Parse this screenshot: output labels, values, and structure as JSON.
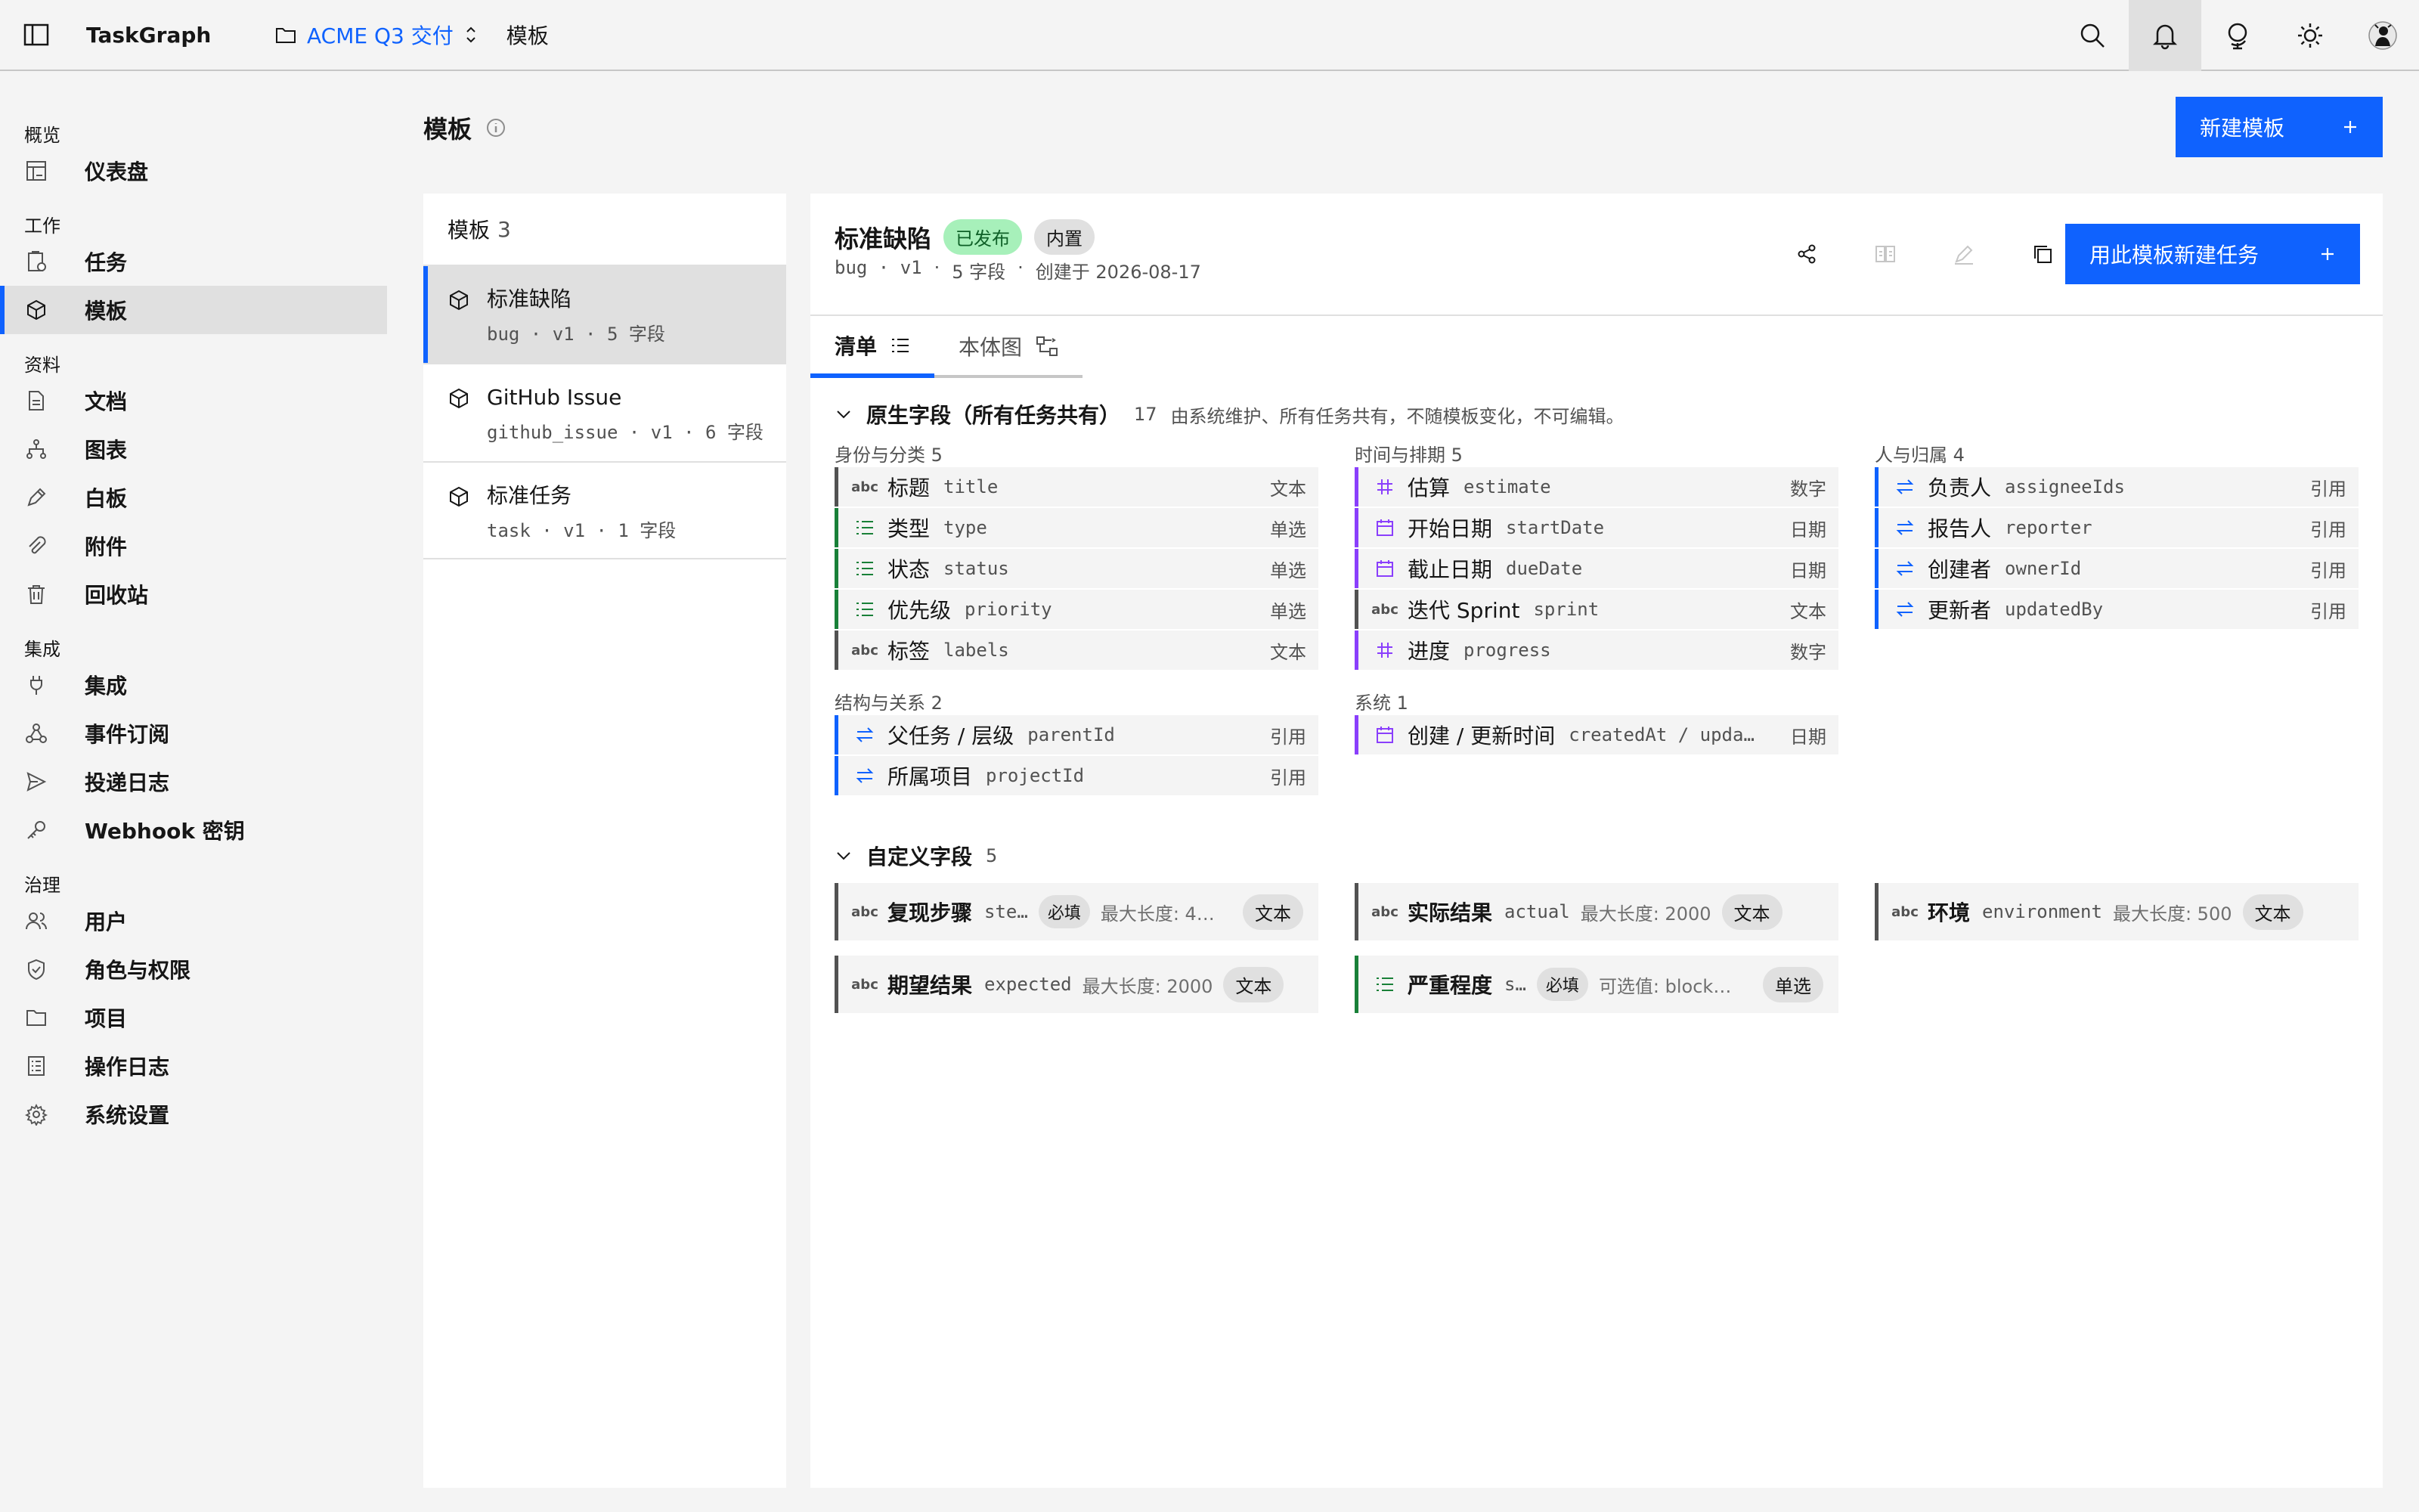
{
  "topbar": {
    "brand": "TaskGraph",
    "project": "ACME Q3 交付",
    "breadcrumb_current": "模板"
  },
  "sidebar": {
    "groups": [
      {
        "label": "概览",
        "items": [
          {
            "label": "仪表盘",
            "icon": "dashboard-icon"
          }
        ]
      },
      {
        "label": "工作",
        "items": [
          {
            "label": "任务",
            "icon": "task-icon"
          },
          {
            "label": "模板",
            "icon": "cube-icon",
            "active": true
          }
        ]
      },
      {
        "label": "资料",
        "items": [
          {
            "label": "文档",
            "icon": "document-icon"
          },
          {
            "label": "图表",
            "icon": "tree-icon"
          },
          {
            "label": "白板",
            "icon": "pen-icon"
          },
          {
            "label": "附件",
            "icon": "paperclip-icon"
          },
          {
            "label": "回收站",
            "icon": "trash-icon"
          }
        ]
      },
      {
        "label": "集成",
        "items": [
          {
            "label": "集成",
            "icon": "plug-icon"
          },
          {
            "label": "事件订阅",
            "icon": "webhook-icon"
          },
          {
            "label": "投递日志",
            "icon": "send-icon"
          },
          {
            "label": "Webhook 密钥",
            "icon": "key-icon"
          }
        ]
      },
      {
        "label": "治理",
        "items": [
          {
            "label": "用户",
            "icon": "users-icon"
          },
          {
            "label": "角色与权限",
            "icon": "shield-icon"
          },
          {
            "label": "项目",
            "icon": "folder-icon"
          },
          {
            "label": "操作日志",
            "icon": "log-icon"
          },
          {
            "label": "系统设置",
            "icon": "gear-icon"
          }
        ]
      }
    ]
  },
  "page": {
    "title": "模板",
    "new_template_label": "新建模板"
  },
  "template_list": {
    "title": "模板",
    "count": "3",
    "items": [
      {
        "name": "标准缺陷",
        "meta": "bug · v1 · 5 字段",
        "active": true
      },
      {
        "name": "GitHub Issue",
        "meta": "github_issue · v1 · 6 字段"
      },
      {
        "name": "标准任务",
        "meta": "task · v1 · 1 字段"
      }
    ]
  },
  "detail": {
    "name": "标准缺陷",
    "status_tag": "已发布",
    "builtin_tag": "内置",
    "meta_key": "bug · v1",
    "meta_fields": "5 字段",
    "meta_created": "创建于 2026-08-17",
    "use_template_label": "用此模板新建任务",
    "tabs": [
      "清单",
      "本体图"
    ]
  },
  "native": {
    "title": "原生字段（所有任务共有）",
    "count": "17",
    "desc": "由系统维护、所有任务共有，不随模板变化，不可编辑。",
    "groups": [
      {
        "title": "身份与分类 5",
        "fields": [
          {
            "name": "标题",
            "key": "title",
            "type": "文本",
            "icon": "abc"
          },
          {
            "name": "类型",
            "key": "type",
            "type": "单选",
            "icon": "list"
          },
          {
            "name": "状态",
            "key": "status",
            "type": "单选",
            "icon": "list"
          },
          {
            "name": "优先级",
            "key": "priority",
            "type": "单选",
            "icon": "list"
          },
          {
            "name": "标签",
            "key": "labels",
            "type": "文本",
            "icon": "abc"
          }
        ]
      },
      {
        "title": "时间与排期 5",
        "fields": [
          {
            "name": "估算",
            "key": "estimate",
            "type": "数字",
            "icon": "hash"
          },
          {
            "name": "开始日期",
            "key": "startDate",
            "type": "日期",
            "icon": "calendar"
          },
          {
            "name": "截止日期",
            "key": "dueDate",
            "type": "日期",
            "icon": "calendar"
          },
          {
            "name": "迭代 Sprint",
            "key": "sprint",
            "type": "文本",
            "icon": "abc"
          },
          {
            "name": "进度",
            "key": "progress",
            "type": "数字",
            "icon": "hash"
          }
        ]
      },
      {
        "title": "人与归属 4",
        "fields": [
          {
            "name": "负责人",
            "key": "assigneeIds",
            "type": "引用",
            "icon": "ref"
          },
          {
            "name": "报告人",
            "key": "reporter",
            "type": "引用",
            "icon": "ref"
          },
          {
            "name": "创建者",
            "key": "ownerId",
            "type": "引用",
            "icon": "ref"
          },
          {
            "name": "更新者",
            "key": "updatedBy",
            "type": "引用",
            "icon": "ref"
          }
        ]
      },
      {
        "title": "结构与关系 2",
        "fields": [
          {
            "name": "父任务 / 层级",
            "key": "parentId",
            "type": "引用",
            "icon": "ref"
          },
          {
            "name": "所属项目",
            "key": "projectId",
            "type": "引用",
            "icon": "ref"
          }
        ]
      },
      {
        "title": "系统 1",
        "fields": [
          {
            "name": "创建 / 更新时间",
            "key": "createdAt / upda…",
            "type": "日期",
            "icon": "calendar"
          }
        ]
      }
    ]
  },
  "custom": {
    "title": "自定义字段",
    "count": "5",
    "fields": [
      {
        "name": "复现步骤",
        "key": "ste…",
        "required": "必填",
        "desc": "最大长度: 4…",
        "type": "文本",
        "icon": "abc"
      },
      {
        "name": "实际结果",
        "key": "actual",
        "desc": "最大长度: 2000",
        "type": "文本",
        "icon": "abc"
      },
      {
        "name": "环境",
        "key": "environment",
        "desc": "最大长度: 500",
        "type": "文本",
        "icon": "abc"
      },
      {
        "name": "期望结果",
        "key": "expected",
        "desc": "最大长度: 2000",
        "type": "文本",
        "icon": "abc"
      },
      {
        "name": "严重程度",
        "key": "s…",
        "required": "必填",
        "desc": "可选值: block…",
        "type": "单选",
        "icon": "list"
      }
    ]
  },
  "colors": {
    "accent": "#0f62fe",
    "text_bar": "#525252",
    "select_bar": "#198038",
    "number_bar": "#8a3ffc",
    "ref_bar": "#0f62fe",
    "published_bg": "#a7f0ba"
  }
}
